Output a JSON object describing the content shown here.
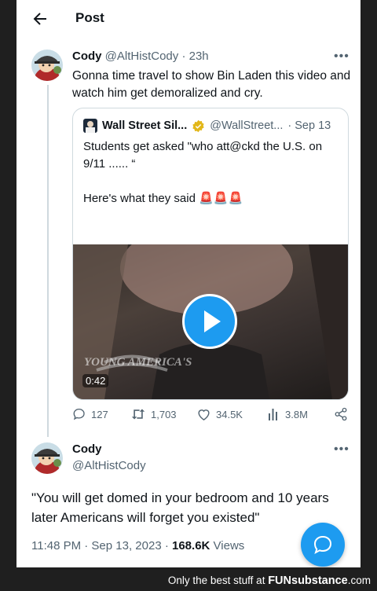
{
  "header": {
    "title": "Post"
  },
  "main_tweet": {
    "name": "Cody",
    "handle": "@AltHistCody",
    "time": "· 23h",
    "text": "Gonna time travel to show Bin Laden this video and watch him get demoralized and cry.",
    "more_icon": "more-dots-icon"
  },
  "quoted_tweet": {
    "name": "Wall Street Sil...",
    "handle": "@WallStreet...",
    "date": "· Sep 13",
    "text_line1": "Students get asked \"who att@ckd the U.S. on 9/11 ...... “",
    "text_line2": "Here's what they said 🚨🚨🚨",
    "video_duration": "0:42",
    "watermark": "YOUNG AMERICA'S"
  },
  "actions": {
    "replies": "127",
    "reposts": "1,703",
    "likes": "34.5K",
    "views": "3.8M"
  },
  "reply_tweet": {
    "name": "Cody",
    "handle": "@AltHistCody",
    "text": "\"You will get domed in your bedroom and 10 years later Americans will forget you existed\"",
    "timestamp": "11:48 PM · Sep 13, 2023 · ",
    "views_count": "168.6K",
    "views_label": " Views"
  },
  "footer": {
    "text": "Only the best stuff at ",
    "brand": "FUNsubstance",
    "suffix": ".com"
  },
  "colors": {
    "accent": "#1d9bf0",
    "muted": "#536471",
    "verified": "#e2b719"
  }
}
